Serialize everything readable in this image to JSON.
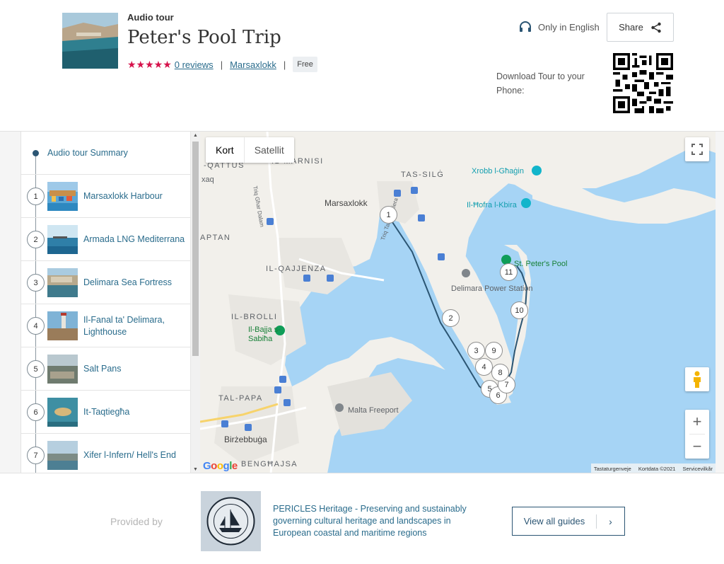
{
  "header": {
    "kicker": "Audio tour",
    "title": "Peter's Pool Trip",
    "stars": "★★★★★",
    "reviews": "0 reviews",
    "separator": "|",
    "location": "Marsaxlokk",
    "price": "Free",
    "language": "Only in English",
    "share_label": "Share",
    "download_text": "Download Tour to your Phone:"
  },
  "sidebar": {
    "summary_label": "Audio tour Summary",
    "stops": [
      {
        "num": "1",
        "label": "Marsaxlokk Harbour"
      },
      {
        "num": "2",
        "label": "Armada LNG Mediterrana"
      },
      {
        "num": "3",
        "label": "Delimara Sea Fortress"
      },
      {
        "num": "4",
        "label": "Il-Fanal ta' Delimara, Lighthouse"
      },
      {
        "num": "5",
        "label": "Salt Pans"
      },
      {
        "num": "6",
        "label": "It-Taqtiegħa"
      },
      {
        "num": "7",
        "label": "Xifer l-Infern/ Hell's End"
      }
    ]
  },
  "map": {
    "type_map": "Kort",
    "type_satellite": "Satellit",
    "labels": {
      "qattus": "-QATTUS",
      "xaq": "xaq",
      "marnisi": "IL-MARNISI",
      "tas_silg": "TAS-SILĠ",
      "marsaxlokk": "Marsaxlokk",
      "aptan": "APTAN",
      "qajjenza": "IL-QAJJENZA",
      "brolli": "IL-BROLLI",
      "tal_papa": "TAL-PAPA",
      "birzebbuga": "Birżebbuġa",
      "benghajsa": "BENGĦAJSA",
      "tal_triq": "Triq Għar Dalam",
      "tat_triq": "Triq Tat-Trunċiera"
    },
    "pois": {
      "xrobb": "Xrobb l-Għaġin",
      "hofra": "Il-Ħofra l-Kbira",
      "peters_pool": "St. Peter's Pool",
      "power_station": "Delimara Power Station",
      "bajja": "Il-Bajja s-Sabiħa",
      "freeport": "Malta Freeport"
    },
    "markers": [
      "1",
      "2",
      "3",
      "4",
      "5",
      "6",
      "7",
      "8",
      "9",
      "10",
      "11"
    ],
    "attribution": {
      "shortcuts": "Tastaturgenveje",
      "data": "Kortdata ©2021",
      "terms": "Servicevilkår"
    },
    "google": "Google",
    "zoom_in": "+",
    "zoom_out": "−"
  },
  "footer": {
    "provided_by": "Provided by",
    "provider_text": "PERICLES Heritage - Preserving and sustainably governing cultural heritage and landscapes in European coastal and maritime regions",
    "view_all": "View all guides",
    "chevron": "›"
  },
  "colors": {
    "accent": "#2a6c8c",
    "stars": "#d6124b",
    "sea": "#a6d4f5",
    "land": "#f2f0eb",
    "route": "#2b5573"
  }
}
